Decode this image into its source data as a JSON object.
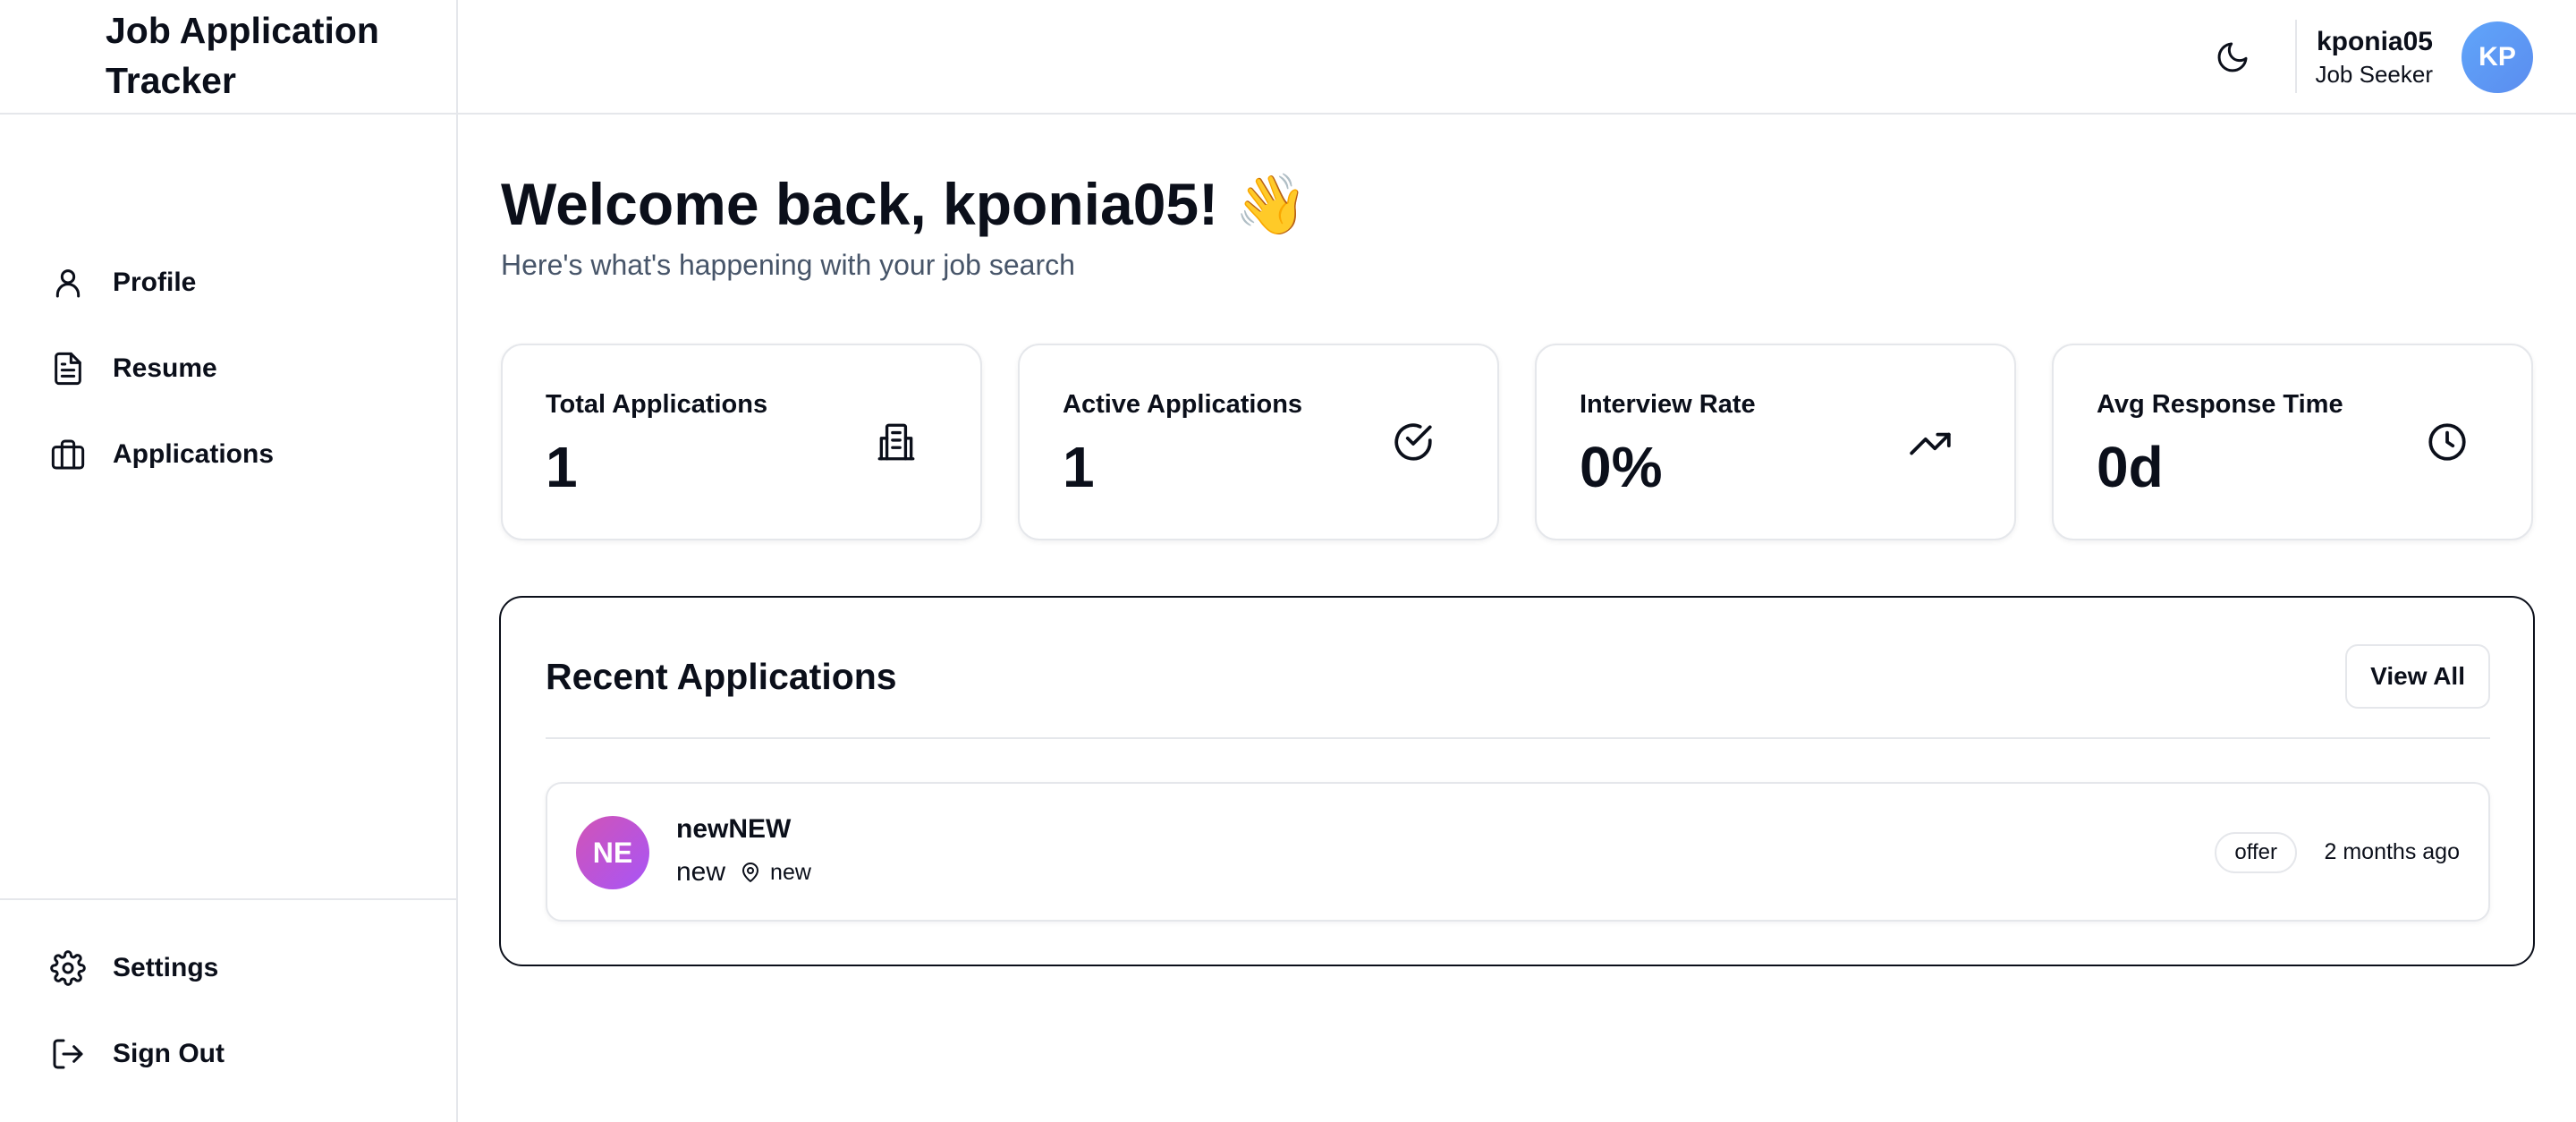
{
  "app": {
    "title": "Job Application Tracker"
  },
  "sidebar": {
    "items": [
      {
        "label": "Profile",
        "icon": "user-icon"
      },
      {
        "label": "Resume",
        "icon": "document-icon"
      },
      {
        "label": "Applications",
        "icon": "briefcase-icon"
      }
    ],
    "bottom_items": [
      {
        "label": "Settings",
        "icon": "gear-icon"
      },
      {
        "label": "Sign Out",
        "icon": "sign-out-icon"
      }
    ]
  },
  "header": {
    "theme_toggle_icon": "moon-icon",
    "user": {
      "name": "kponia05",
      "role": "Job Seeker",
      "initials": "KP"
    }
  },
  "main": {
    "welcome": "Welcome back, kponia05! 👋",
    "subtitle": "Here's what's happening with your job search",
    "stats": [
      {
        "title": "Total Applications",
        "value": "1",
        "icon": "building-icon"
      },
      {
        "title": "Active Applications",
        "value": "1",
        "icon": "check-circle-icon"
      },
      {
        "title": "Interview Rate",
        "value": "0%",
        "icon": "trending-up-icon"
      },
      {
        "title": "Avg Response Time",
        "value": "0d",
        "icon": "clock-icon"
      }
    ],
    "recent": {
      "title": "Recent Applications",
      "view_all_label": "View All",
      "applications": [
        {
          "initials": "NE",
          "company": "newNEW",
          "position": "new",
          "location": "new",
          "status": "offer",
          "time": "2 months ago"
        }
      ]
    }
  },
  "colors": {
    "text": "#0b0f1a",
    "muted": "#475569",
    "border": "#e5e7eb",
    "user_avatar": "#5b8def",
    "company_avatar": "#c055c6"
  }
}
